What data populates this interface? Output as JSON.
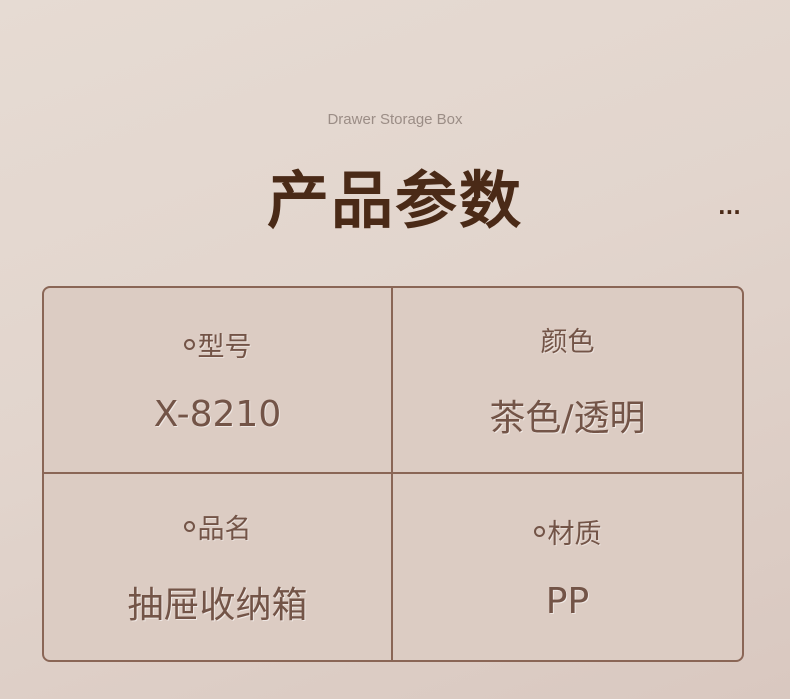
{
  "subtitle": "Drawer Storage Box",
  "title": "产品参数",
  "more": "...",
  "params": [
    {
      "label": "型号",
      "value": "X-8210",
      "bullet": true
    },
    {
      "label": "颜色",
      "value": "茶色/透明",
      "bullet": false
    },
    {
      "label": "品名",
      "value": "抽屉收纳箱",
      "bullet": true
    },
    {
      "label": "材质",
      "value": "PP",
      "bullet": true
    }
  ]
}
